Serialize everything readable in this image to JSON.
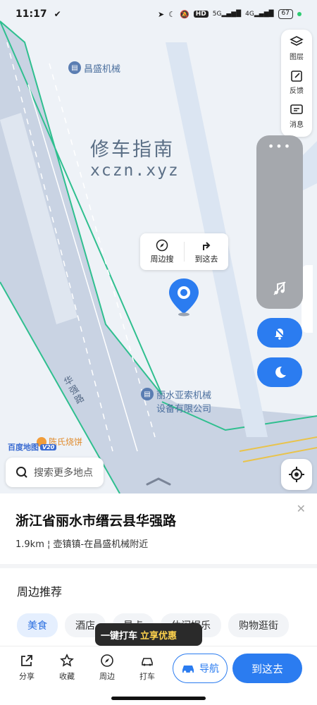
{
  "status_bar": {
    "time": "11:17",
    "left_icon": "v-check-icon",
    "hd": "HD",
    "signal_1": "5G",
    "signal_2": "4G",
    "battery": "67"
  },
  "map": {
    "poi_top": "昌盛机械",
    "poi_company_line1": "丽水亚索机械",
    "poi_company_line2": "设备有限公司",
    "watermark_title": "修车指南",
    "watermark_url": "xczn.xyz",
    "road_name": "华强路",
    "brand": "百度地图",
    "brand_version": "V20",
    "shop": "陈氏烧饼",
    "tools": [
      {
        "label": "图层",
        "icon": "layers-icon"
      },
      {
        "label": "反馈",
        "icon": "feedback-icon"
      },
      {
        "label": "消息",
        "icon": "message-icon"
      }
    ],
    "callout": {
      "left": "周边搜",
      "right": "到这去"
    },
    "search_placeholder": "搜索更多地点"
  },
  "place": {
    "title": "浙江省丽水市缙云县华强路",
    "distance": "1.9km",
    "description": "壶镇镇-在昌盛机械附近"
  },
  "nearby": {
    "title": "周边推荐",
    "chips": [
      "美食",
      "酒店",
      "景点",
      "休闲娱乐",
      "购物逛街"
    ],
    "active_index": 0
  },
  "promo": {
    "text": "一键打车",
    "highlight": "立享优惠"
  },
  "bottom_bar": {
    "items": [
      {
        "label": "分享",
        "icon": "share-icon"
      },
      {
        "label": "收藏",
        "icon": "star-icon"
      },
      {
        "label": "周边",
        "icon": "compass-icon"
      },
      {
        "label": "打车",
        "icon": "taxi-icon"
      }
    ],
    "nav_label": "导航",
    "go_label": "到这去"
  },
  "colors": {
    "accent": "#2b7cf0",
    "road": "#c9d3e3",
    "map_bg": "#eef2f7"
  }
}
